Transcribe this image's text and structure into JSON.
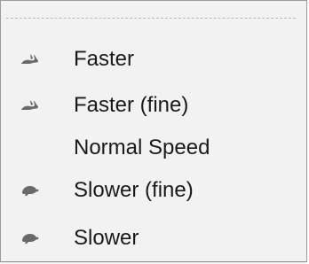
{
  "menu": {
    "items": [
      {
        "label": "Faster",
        "icon": "rabbit-icon"
      },
      {
        "label": "Faster (fine)",
        "icon": "rabbit-icon"
      },
      {
        "label": "Normal Speed",
        "icon": ""
      },
      {
        "label": "Slower (fine)",
        "icon": "turtle-icon"
      },
      {
        "label": "Slower",
        "icon": "turtle-icon"
      }
    ]
  },
  "colors": {
    "menu_background": "#f2f2f2",
    "menu_border": "#9a9a9a",
    "text": "#1a1a1a",
    "icon": "#6a6a6a"
  }
}
